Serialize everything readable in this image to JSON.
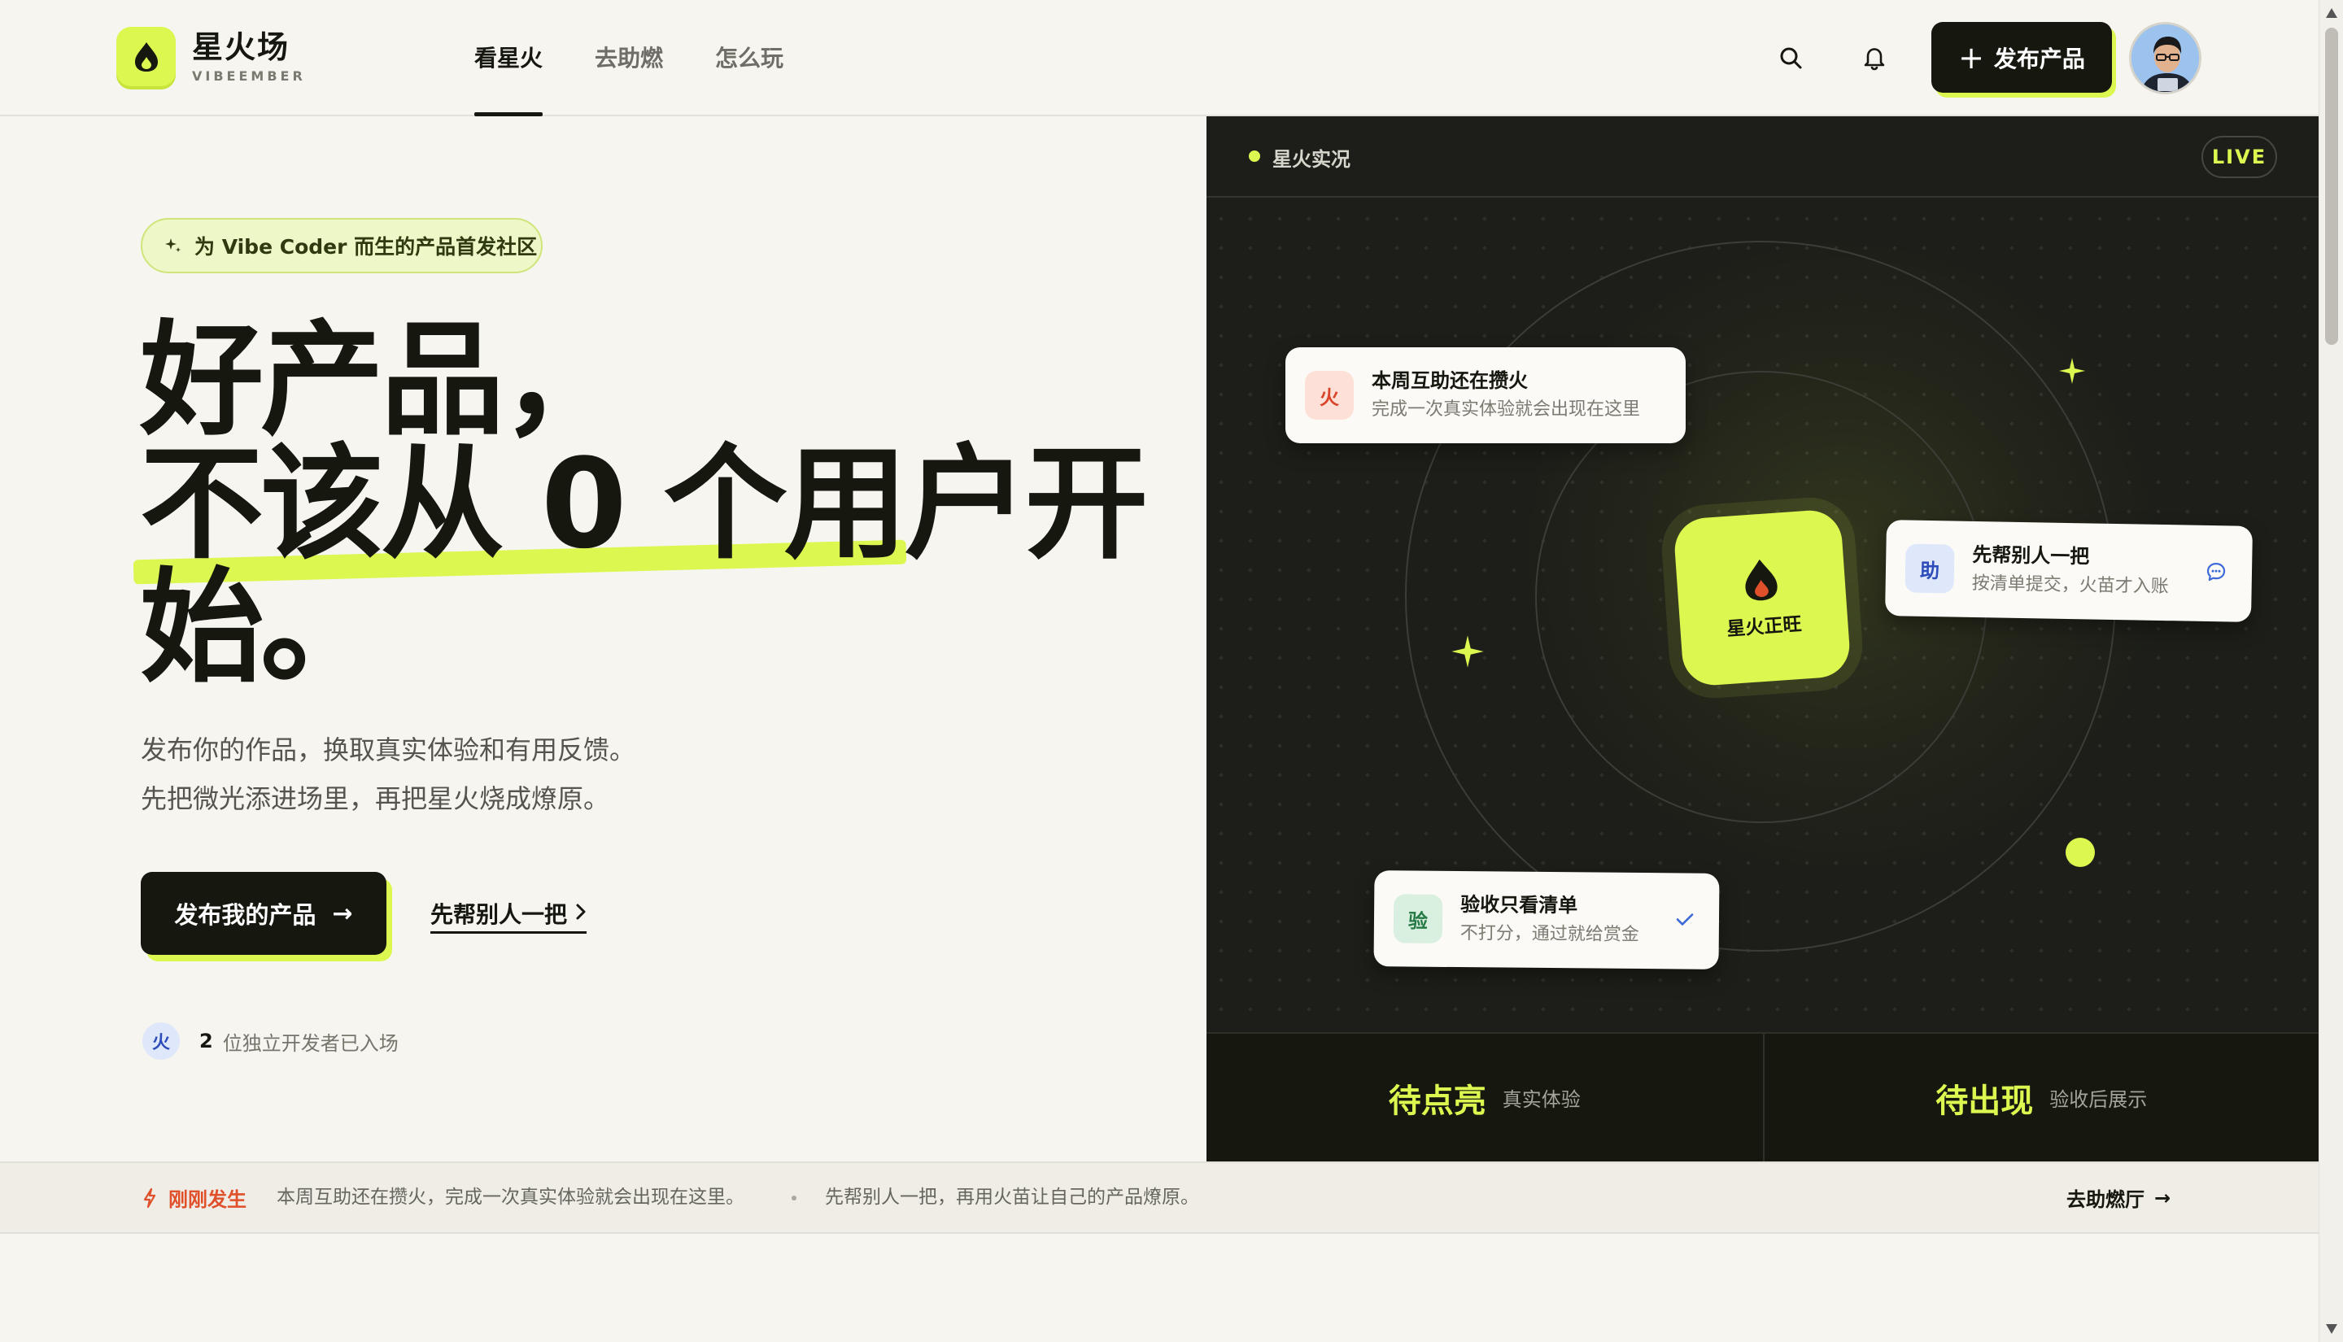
{
  "brand": {
    "name": "星火场",
    "sub": "VIBEEMBER"
  },
  "nav": {
    "items": [
      {
        "label": "看星火"
      },
      {
        "label": "去助燃"
      },
      {
        "label": "怎么玩"
      }
    ]
  },
  "header": {
    "publish_label": "发布产品"
  },
  "hero": {
    "tag": "为 Vibe Coder 而生的产品首发社区",
    "headline_lines": [
      "好产品，",
      "不该从 0 个用户开",
      "始。"
    ],
    "subcopy_lines": [
      "发布你的作品，换取真实体验和有用反馈。",
      "先把微光添进场里，再把星火烧成燎原。"
    ],
    "cta_primary": "发布我的产品",
    "cta_secondary": "先帮别人一把",
    "joined": {
      "badge": "火",
      "count": "2",
      "text": "位独立开发者已入场"
    }
  },
  "live": {
    "label": "星火实况",
    "badge": "LIVE",
    "core_label": "星火正旺",
    "cards": [
      {
        "icon_text": "火",
        "title": "本周互助还在攒火",
        "desc": "完成一次真实体验就会出现在这里"
      },
      {
        "icon_text": "助",
        "title": "先帮别人一把",
        "desc": "按清单提交，火苗才入账"
      },
      {
        "icon_text": "验",
        "title": "验收只看清单",
        "desc": "不打分，通过就给赏金"
      }
    ],
    "stats": [
      {
        "value": "待点亮",
        "label": "真实体验"
      },
      {
        "value": "待出现",
        "label": "验收后展示"
      }
    ]
  },
  "ticker": {
    "head": "刚刚发生",
    "items": [
      "本周互助还在攒火，完成一次真实体验就会出现在这里。",
      "先帮别人一把，再用火苗让自己的产品燎原。"
    ],
    "link": "去助燃厅"
  },
  "colors": {
    "accent": "#dcf74f",
    "dark": "#16170f",
    "background": "#f7f5ef",
    "alert": "#e0502b"
  }
}
